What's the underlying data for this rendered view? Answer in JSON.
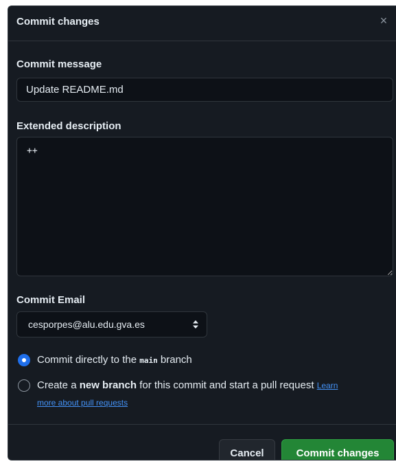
{
  "dialog": {
    "title": "Commit changes",
    "close_symbol": "×"
  },
  "form": {
    "commit_message_label": "Commit message",
    "commit_message_value": "Update README.md",
    "extended_description_label": "Extended description",
    "extended_description_value": "++",
    "commit_email_label": "Commit Email",
    "commit_email_value": "cesporpes@alu.edu.gva.es"
  },
  "options": {
    "direct": {
      "prefix": "Commit directly to the ",
      "branch": "main",
      "suffix": " branch",
      "checked": true
    },
    "new_branch": {
      "prefix": "Create a ",
      "bold": "new branch",
      "suffix": " for this commit and start a pull request ",
      "learn_part1": "Learn",
      "learn_part2": "more about pull requests",
      "checked": false
    }
  },
  "footer": {
    "cancel_label": "Cancel",
    "commit_label": "Commit changes"
  },
  "icons": {
    "close": "close-icon",
    "select": "select-arrows-icon",
    "radio_checked": "radio-checked-icon",
    "radio_unchecked": "radio-unchecked-icon"
  },
  "colors": {
    "background": "#161b22",
    "input_background": "#0d1117",
    "border": "#30363d",
    "text": "#e6edf3",
    "accent_blue": "#1f6feb",
    "link": "#4493f8",
    "primary_green": "#238636",
    "secondary_button": "#21262d"
  }
}
